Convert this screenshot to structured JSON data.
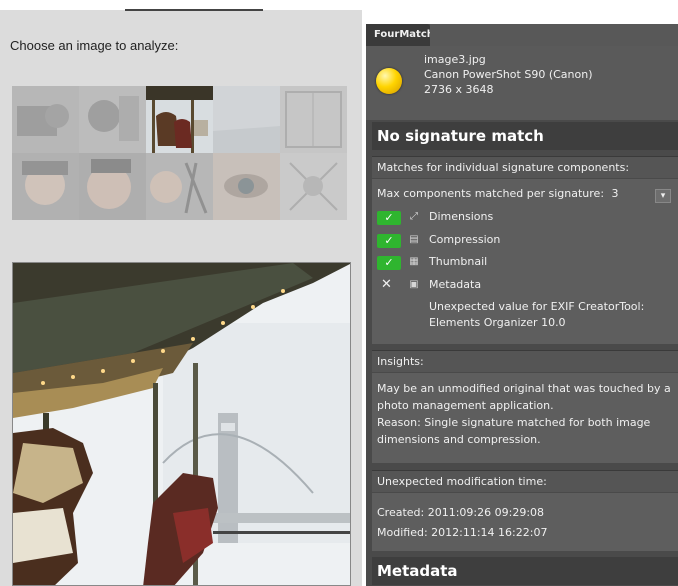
{
  "left": {
    "prompt": "Choose an image to analyze:",
    "thumbnails": [
      {
        "name": "thumb-1"
      },
      {
        "name": "thumb-2"
      },
      {
        "name": "thumb-3"
      },
      {
        "name": "thumb-4"
      },
      {
        "name": "thumb-5"
      },
      {
        "name": "thumb-6"
      },
      {
        "name": "thumb-7"
      },
      {
        "name": "thumb-8"
      },
      {
        "name": "thumb-9"
      },
      {
        "name": "thumb-10"
      }
    ],
    "selected_index": 2
  },
  "panel": {
    "tab_label": "FourMatch",
    "file": {
      "name": "image3.jpg",
      "camera": "Canon PowerShot S90 (Canon)",
      "dimensions": "2736 x 3648"
    },
    "result_title": "No signature match",
    "components_header": "Matches for individual signature components:",
    "max_components_label": "Max components matched per signature:",
    "max_components_value": "3",
    "components": [
      {
        "label": "Dimensions",
        "matched": true,
        "icon": "dimensions-icon"
      },
      {
        "label": "Compression",
        "matched": true,
        "icon": "compression-icon"
      },
      {
        "label": "Thumbnail",
        "matched": true,
        "icon": "thumbnail-icon"
      },
      {
        "label": "Metadata",
        "matched": false,
        "icon": "metadata-icon"
      }
    ],
    "metadata_note_line1": "Unexpected value for EXIF CreatorTool:",
    "metadata_note_line2": "Elements Organizer 10.0",
    "insights_header": "Insights:",
    "insights_line1": "May be an unmodified original that was touched by a",
    "insights_line2": "photo management application.",
    "insights_line3": "Reason: Single signature matched for both image",
    "insights_line4": "dimensions and compression.",
    "modtime_header": "Unexpected modification time:",
    "created": "Created: 2011:09:26 09:29:08",
    "modified": "Modified: 2012:11:14 16:22:07",
    "metadata_section_title": "Metadata"
  },
  "colors": {
    "panel_bg": "#4a4a4a",
    "match_green": "#2fb52f",
    "bulb_yellow": "#ffd400"
  }
}
